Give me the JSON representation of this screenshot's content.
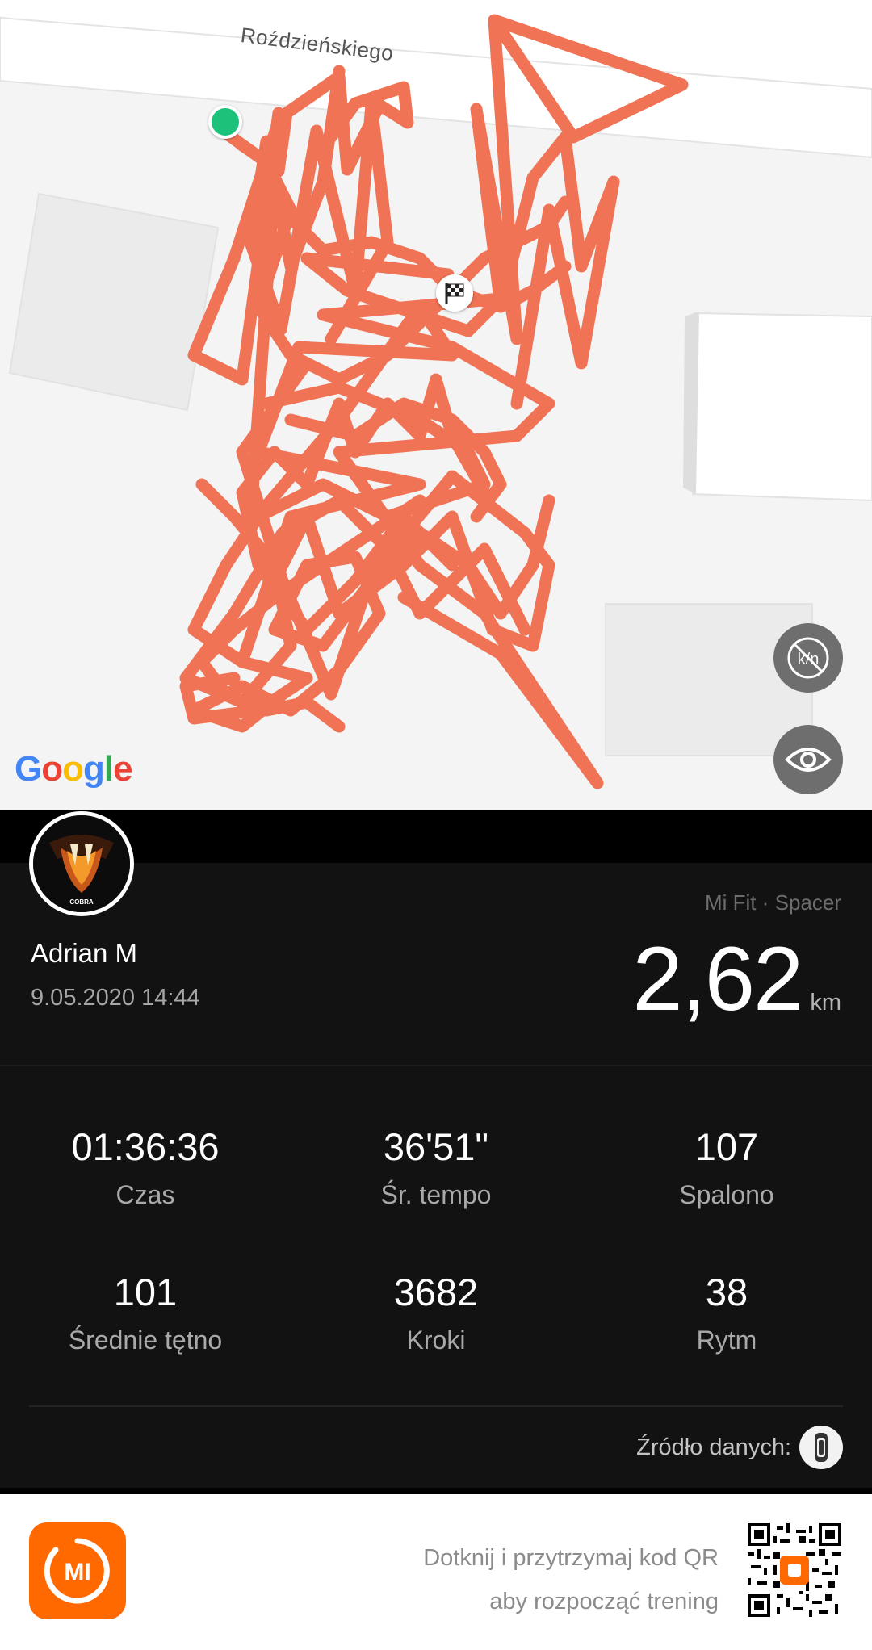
{
  "map": {
    "street_name": "Roździeńskiego",
    "provider_logo": "Google",
    "route_color": "#f07355",
    "start_marker_color": "#1dc27a",
    "icons": {
      "start": "start-dot-icon",
      "finish": "checkered-flag-icon",
      "units_toggle": "km-off-icon",
      "visibility_toggle": "eye-icon"
    }
  },
  "profile": {
    "avatar_label": "COBRA",
    "name": "Adrian M",
    "date": "9.05.2020 14:44",
    "source_app": "Mi Fit · Spacer",
    "distance_value": "2,62",
    "distance_unit": "km"
  },
  "stats": [
    {
      "value": "01:36:36",
      "label": "Czas"
    },
    {
      "value": "36'51\"",
      "label": "Śr. tempo"
    },
    {
      "value": "107",
      "label": "Spalono"
    },
    {
      "value": "101",
      "label": "Średnie tętno"
    },
    {
      "value": "3682",
      "label": "Kroki"
    },
    {
      "value": "38",
      "label": "Rytm"
    }
  ],
  "data_source": {
    "label": "Źródło danych:",
    "icon": "mi-band-icon"
  },
  "footer": {
    "logo_text": "MI",
    "qr_line1": "Dotknij i przytrzymaj kod QR",
    "qr_line2": "aby rozpocząć trening",
    "qr_icon": "qr-code-icon"
  },
  "colors": {
    "accent": "#ff6900",
    "panel": "#121212",
    "route": "#f07355"
  }
}
